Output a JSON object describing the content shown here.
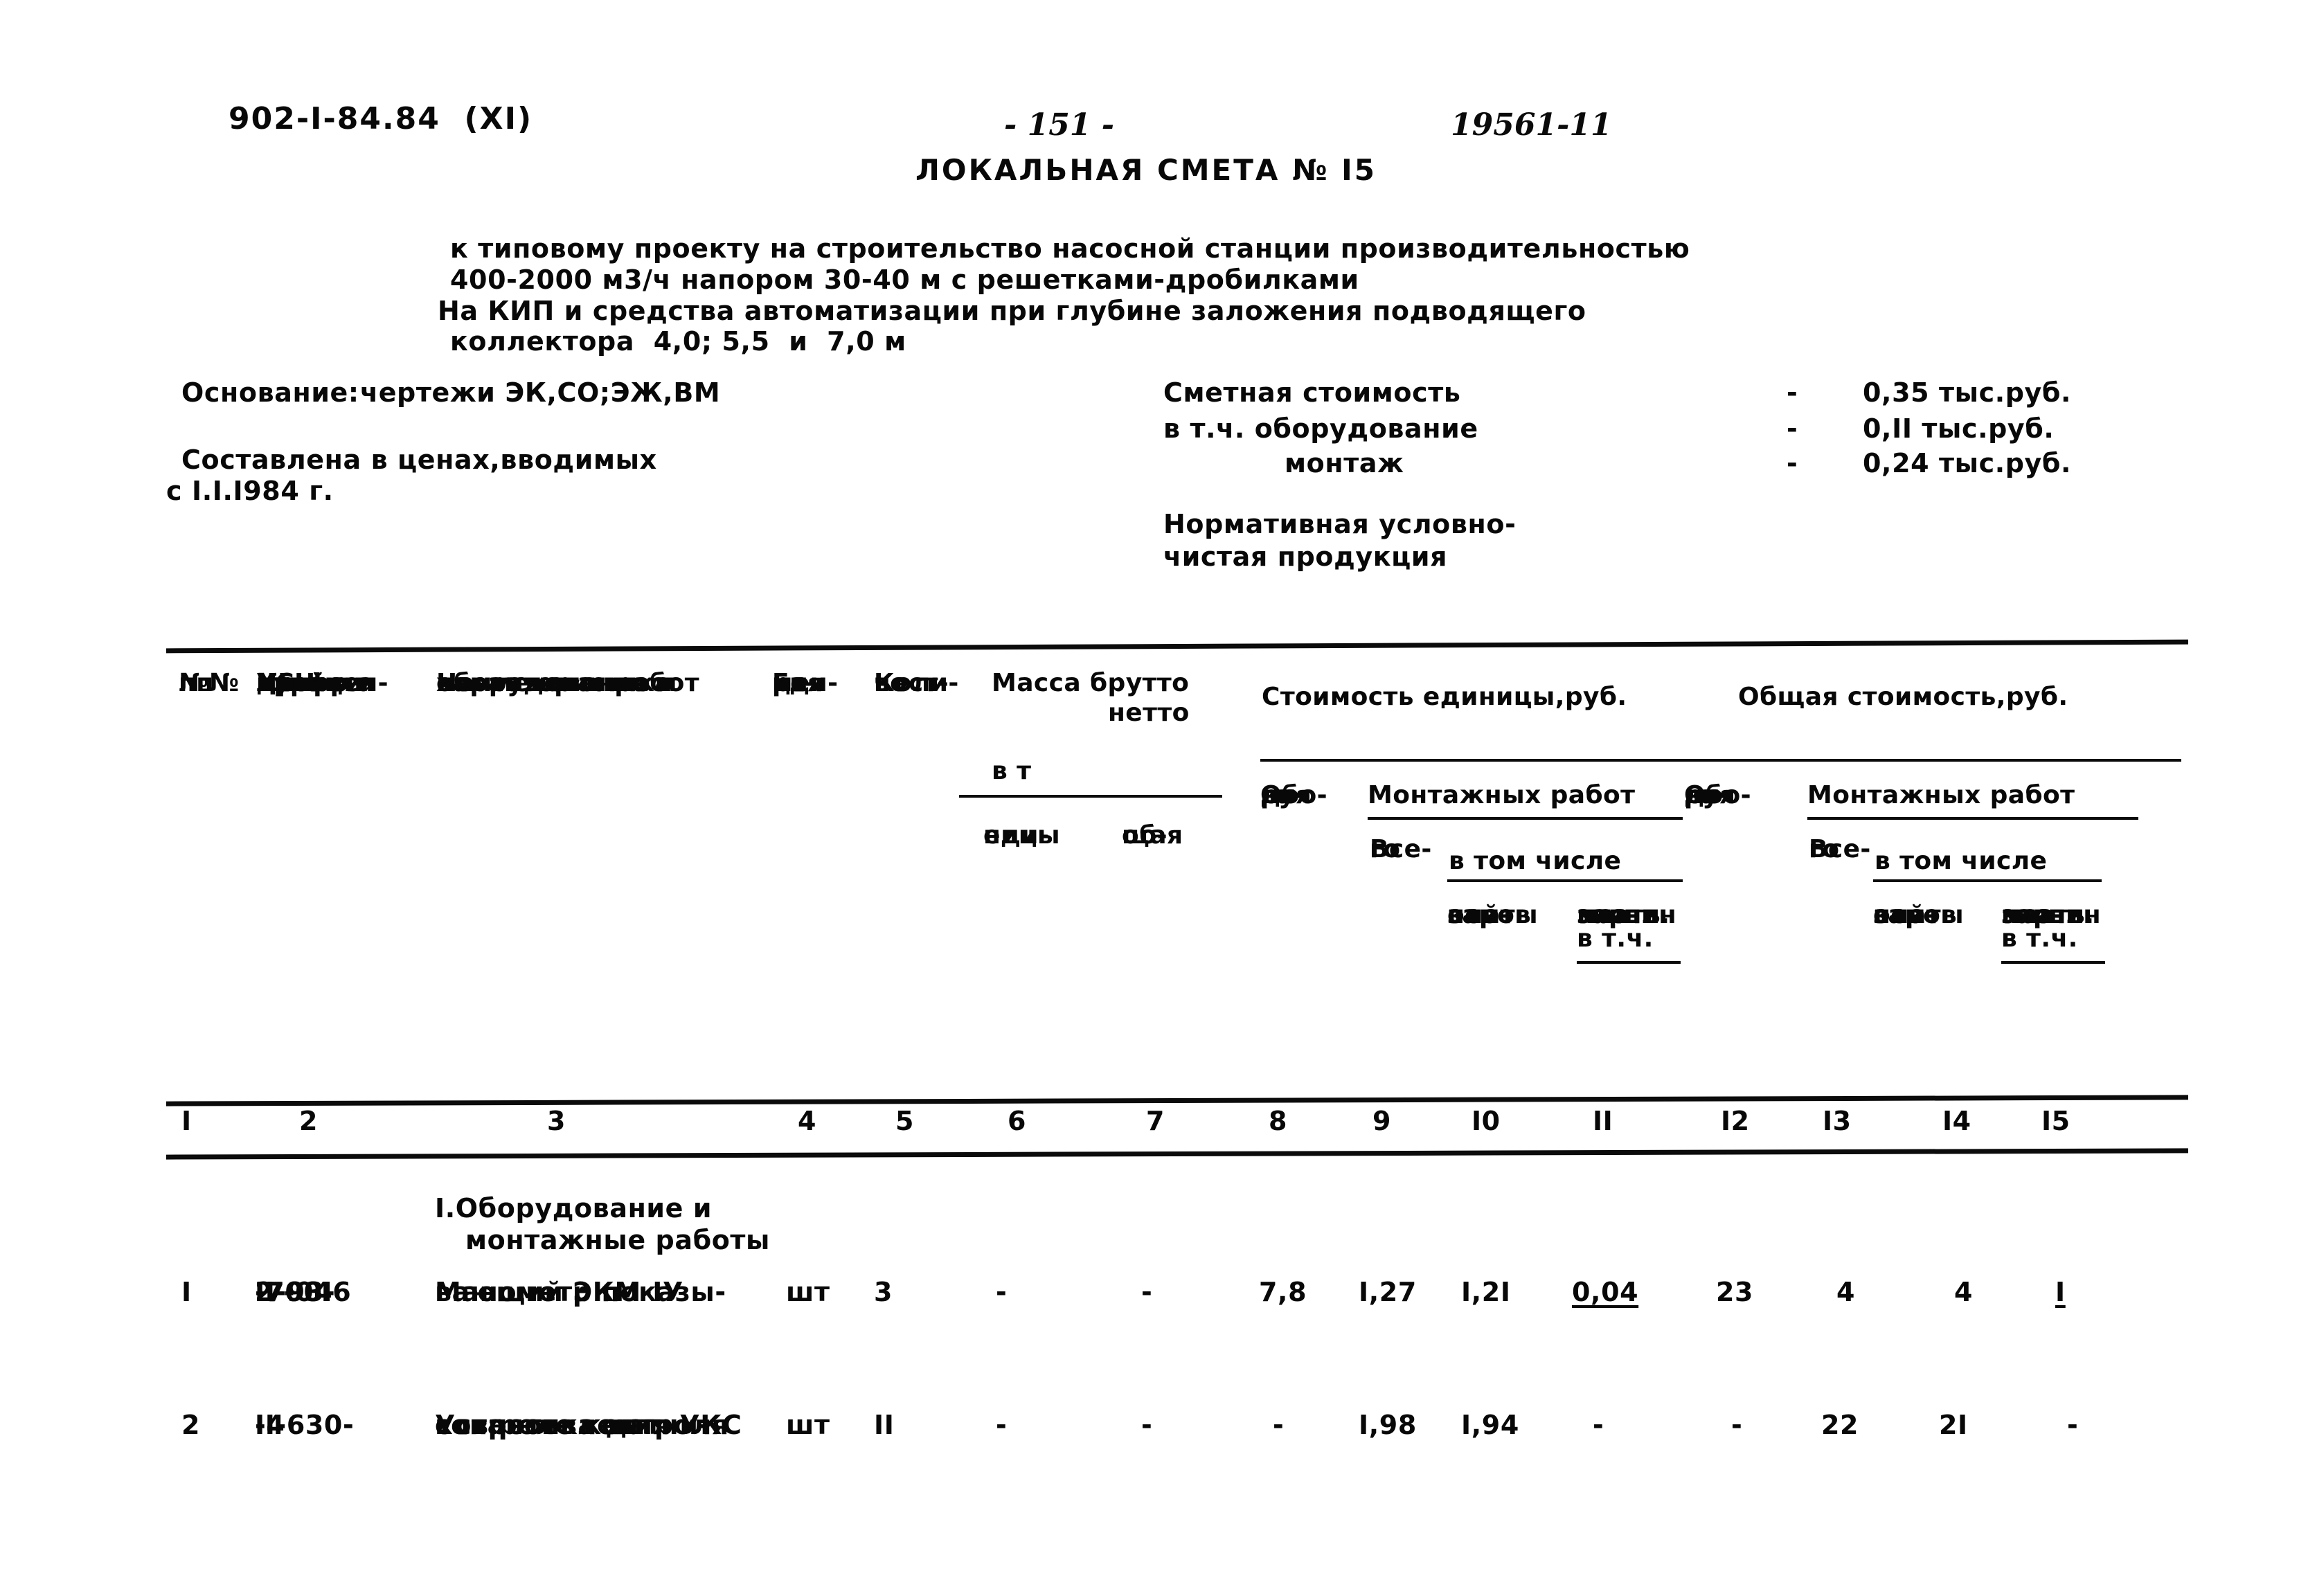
{
  "header": {
    "project_code": "902-I-84.84  (XI)",
    "page_number": "- 151 -",
    "handwritten_note": "19561-11"
  },
  "title": {
    "main": "ЛОКАЛЬНАЯ СМЕТА № I5",
    "subtitle_lines": [
      "к типовому проекту на строительство насосной станции производительностью",
      "400-2000 м3/ч напором 30-40 м с решетками-дробилками",
      "На КИП и средства автоматизации при глубине заложения подводящего",
      "коллектора  4,0; 5,5  и  7,0 м"
    ]
  },
  "info_left": {
    "basis_label": "Основание:",
    "basis_value": "чертежи ЭК,СО;ЭЖ,ВМ",
    "prices_line1": "Составлена в ценах,вводимых",
    "prices_line2": "с I.I.I984 г."
  },
  "summary": {
    "rows": [
      {
        "label": "Сметная стоимость",
        "dash": "-",
        "value": "0,35 тыс.руб."
      },
      {
        "label": "в т.ч. оборудование",
        "dash": "-",
        "value": "0,II тыс.руб."
      },
      {
        "label": "монтаж",
        "dash": "-",
        "value": "0,24 тыс.руб."
      }
    ],
    "net_output_line1": "Нормативная условно-",
    "net_output_line2": "чистая продукция"
  },
  "table": {
    "headers": {
      "c1_l1": "№№",
      "c1_l2": "пп",
      "c2_l1": "Шифр и",
      "c2_l2": "№ пози-",
      "c2_l3": "ции",
      "c2_l4": "прейс-",
      "c2_l5": "куранта",
      "c2_l6": "УСН цен-",
      "c2_l7": "ника и",
      "c2_l8": "др.",
      "c3_l1": "Наименование и",
      "c3_l2": "характеристика",
      "c3_l3": "оборудования и",
      "c3_l4": "монтажных работ",
      "c4_l1": "Еди-",
      "c4_l2": "ни-",
      "c4_l3": "ца",
      "c4_l4": "из-",
      "c4_l5": "ме-",
      "c4_l6": "ре-",
      "c4_l7": "ния",
      "c5_l1": "Коли-",
      "c5_l2": "чест-",
      "c5_l3": "во",
      "mass_brutto": "Масса брутто",
      "mass_netto": "нетто",
      "mass_unit": "в т",
      "c6_l1": "еди-",
      "c6_l2": "ницы",
      "c7_l1": "об-",
      "c7_l2": "щая",
      "unit_cost": "Стоимость единицы,руб.",
      "total_cost": "Общая стоимость,руб.",
      "equip_l1": "Обо-",
      "equip_l2": "ру-",
      "equip_l3": "до-",
      "equip_l4": "ва-",
      "equip_l5": "ния",
      "assembly": "Монтажных работ",
      "total_l1": "Все-",
      "total_l2": "го",
      "including": "в том числе",
      "base_l1": "основ",
      "base_l2": "ной",
      "base_l3": "зар-",
      "base_l4": "платы",
      "mach_l1": "экспл.",
      "mach_l2": "машин",
      "mach_l3": "в т.ч.",
      "mach_l4": "зар-",
      "mach_l5": "платы"
    },
    "column_numbers": [
      "I",
      "2",
      "3",
      "4",
      "5",
      "6",
      "7",
      "8",
      "9",
      "I0",
      "II",
      "I2",
      "I3",
      "I4",
      "I5"
    ],
    "section_title_l1": "I.Оборудование и",
    "section_title_l2": "монтажные работы",
    "rows": [
      {
        "no": "I",
        "code_lines": [
          "I7-04",
          "2-00I6",
          "II-93-",
          "-7"
        ],
        "name_lines": [
          "Манометр показы-",
          "вающий ЭКМ-IУ"
        ],
        "unit": "шт",
        "qty": "3",
        "mass_unit": "-",
        "mass_total": "-",
        "unit_equipment": "7,8",
        "unit_assembly_total": "I,27",
        "unit_base_salary": "I,2I",
        "unit_machines": "0,04",
        "unit_machines_underline": true,
        "total_equipment": "23",
        "total_assembly_total": "4",
        "total_base_salary": "4",
        "total_machines": "I",
        "total_machines_underline": true
      },
      {
        "no": "2",
        "code_lines": [
          "II-630-",
          "-4"
        ],
        "name_lines": [
          "Установка датчи-",
          "ков реле контроля",
          "сопротивления УКС"
        ],
        "unit": "шт",
        "qty": "II",
        "mass_unit": "-",
        "mass_total": "-",
        "unit_equipment": "-",
        "unit_assembly_total": "I,98",
        "unit_base_salary": "I,94",
        "unit_machines": "-",
        "unit_machines_underline": false,
        "total_equipment": "-",
        "total_assembly_total": "22",
        "total_base_salary": "2I",
        "total_machines": "-",
        "total_machines_underline": false
      }
    ]
  }
}
